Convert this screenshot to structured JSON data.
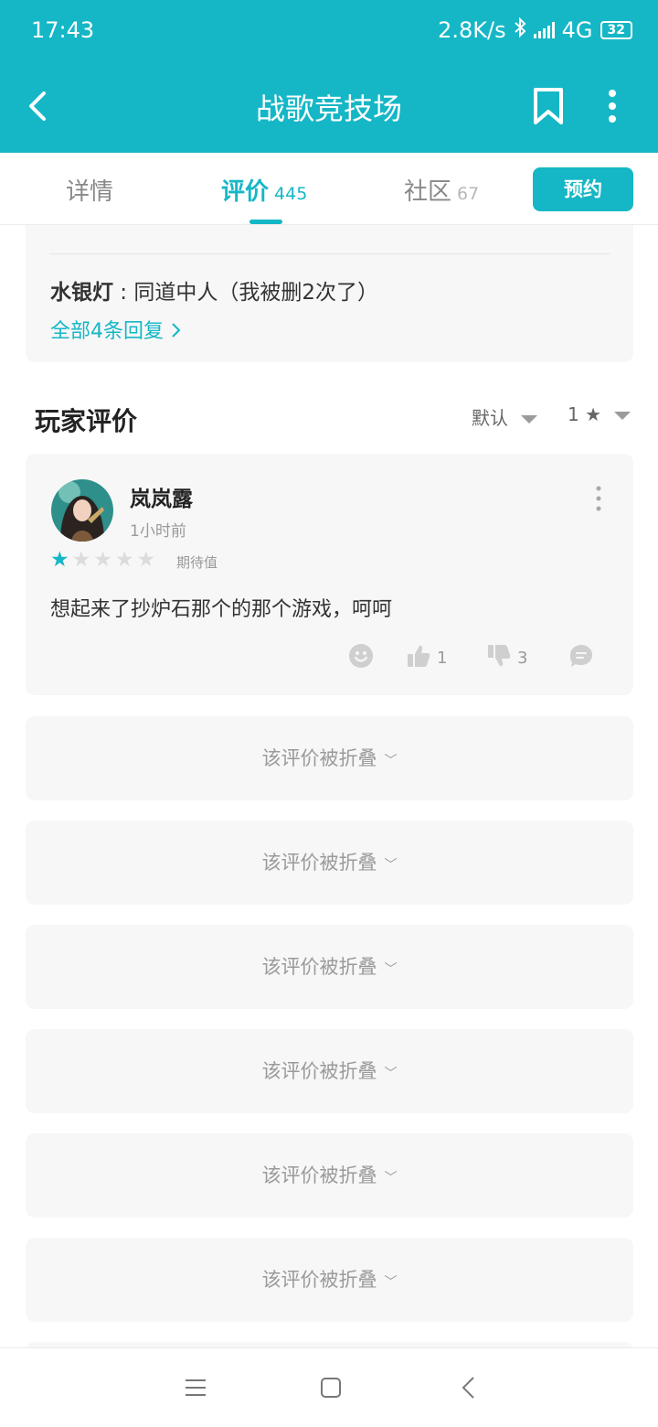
{
  "status_bar": {
    "time": "17:43",
    "network_speed": "2.8K/s",
    "network_type": "4G",
    "battery": "32"
  },
  "nav": {
    "title": "战歌竞技场",
    "back_icon": "back-arrow-icon",
    "bookmark_icon": "bookmark-icon",
    "more_icon": "more-vertical-icon"
  },
  "tabs": [
    {
      "label": "详情",
      "count": ""
    },
    {
      "label": "评价",
      "count": "445"
    },
    {
      "label": "社区",
      "count": "67"
    }
  ],
  "reserve_label": "预约",
  "reply_preview": {
    "author": "水银灯",
    "separator": " : ",
    "text": "同道中人（我被删2次了）",
    "more_label": "全部4条回复"
  },
  "reviews_section": {
    "title": "玩家评价",
    "sort_label": "默认",
    "star_filter_label": "1 ★"
  },
  "review": {
    "name": "岚岚露",
    "time": "1小时前",
    "rating": 1,
    "rating_max": 5,
    "tag": "期待值",
    "text": "想起来了抄炉石那个的那个游戏，呵呵",
    "likes": "1",
    "dislikes": "3"
  },
  "folded_label": "该评价被折叠",
  "colors": {
    "accent": "#15b7c6",
    "card_bg": "#f7f7f7"
  }
}
